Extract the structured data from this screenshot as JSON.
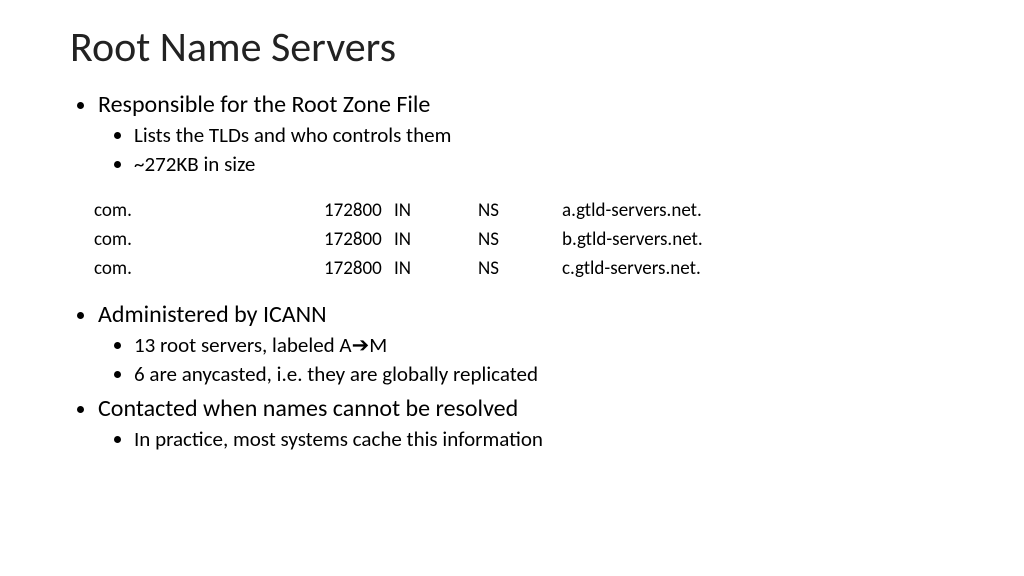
{
  "title": "Root Name Servers",
  "bullets1": {
    "main": "Responsible for the Root Zone File",
    "sub1": "Lists the TLDs and who controls them",
    "sub2": "~272KB in size"
  },
  "zone": [
    {
      "name": "com.",
      "ttl": "172800",
      "cls": "IN",
      "type": "NS",
      "value": "a.gtld-servers.net."
    },
    {
      "name": "com.",
      "ttl": "172800",
      "cls": "IN",
      "type": "NS",
      "value": "b.gtld-servers.net."
    },
    {
      "name": "com.",
      "ttl": "172800",
      "cls": "IN",
      "type": "NS",
      "value": "c.gtld-servers.net."
    }
  ],
  "bullets2": {
    "main": "Administered by ICANN",
    "sub1_pre": "13 root servers, labeled A",
    "sub1_post": "M",
    "sub2": "6 are anycasted, i.e. they are globally replicated"
  },
  "bullets3": {
    "main": "Contacted when names cannot be resolved",
    "sub1": "In practice, most systems cache this information"
  }
}
